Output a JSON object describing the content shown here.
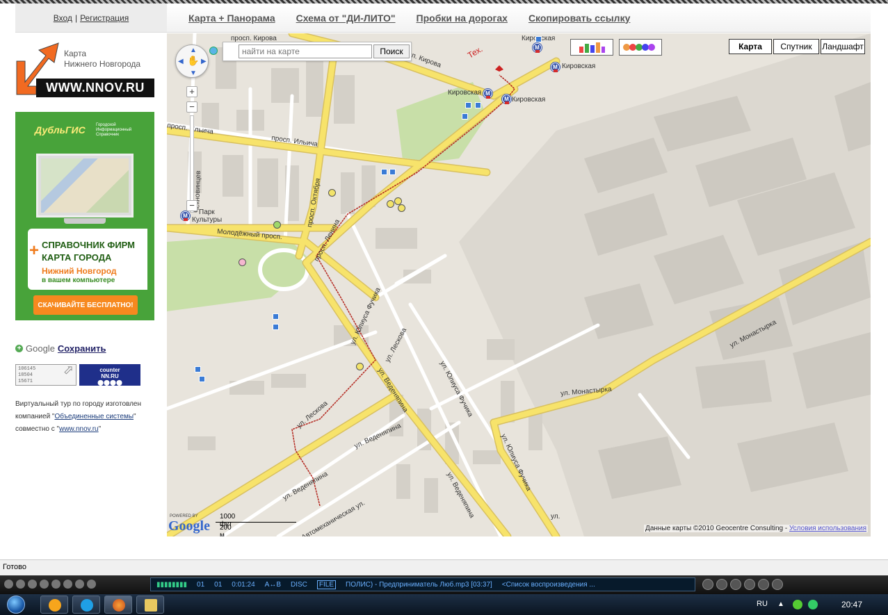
{
  "header": {
    "auth": {
      "login": "Вход",
      "separator": "|",
      "register": "Регистрация"
    },
    "nav": [
      {
        "label": "Карта + Панорама"
      },
      {
        "label": "Схема от \"ДИ-ЛИТО\""
      },
      {
        "label": "Пробки на дорогах"
      },
      {
        "label": "Скопировать ссылку"
      }
    ]
  },
  "sidebar": {
    "logo": {
      "line1": "Карта",
      "line2": "Нижнего Новгорода",
      "url": "WWW.NNOV.RU"
    },
    "banner": {
      "brand": "ДубльГИС",
      "brand_sub": "Городской Информационный Справочник",
      "line1": "СПРАВОЧНИК ФИРМ",
      "line2": "КАРТА ГОРОДА",
      "line3": "Нижний Новгород",
      "line4": "в вашем компьютере",
      "button": "СКАЧИВАЙТЕ БЕСПЛАТНО!"
    },
    "google_save": {
      "brand": "Google",
      "label": "Сохранить"
    },
    "counter1": {
      "l1": "106145",
      "l2": "18504",
      "l3": "15671"
    },
    "counter2": {
      "l1": "counter",
      "l2": "NN.RU"
    },
    "tour": {
      "t1": "Виртуальный тур по городу изготовлен компанией \"",
      "link1": "Объединенные системы",
      "t2": "\" совместно с \"",
      "link2": "www.nnov.ru",
      "t3": "\""
    }
  },
  "map": {
    "search": {
      "placeholder": "найти на карте",
      "button": "Поиск"
    },
    "types": [
      {
        "label": "Карта",
        "active": true
      },
      {
        "label": "Спутник"
      },
      {
        "label": "Ландшафт"
      }
    ],
    "labels": {
      "kirova_top": "просп. Кирова",
      "kirova": "просп. Кирова",
      "ilicha_left": "просп. Ильича",
      "ilicha": "просп. Ильича",
      "oktyabrya": "просп. Октября",
      "molodezhny": "Молодёжный просп.",
      "lenina": "просп. Ленина",
      "fuchika1": "ул. Юлиуса Фучика",
      "fuchika2": "ул. Юлиуса Фучика",
      "fuchika3": "ул. Юлиуса Фучика",
      "leskova1": "ул. Лескова",
      "leskova2": "ул. Лескова",
      "vedenyapina1": "ул. Веденяпина",
      "vedenyapina2": "ул. Веденяпина",
      "vedenyapina3": "ул. Веденяпина",
      "vedenyapina4": "ул. Веденяпина",
      "monastyrka1": "ул. Монастырка",
      "monastyrka2": "ул. Монастырка",
      "avtomeh": "Автомеханическая ул.",
      "chekhonin": "Чекновинцев",
      "park": "Парк",
      "park2": "Культуры",
      "kirovskaya1": "Кировская",
      "kirovskaya2": "Кировская",
      "kirovskaya3": "Кировская",
      "kirovskaya4": "Кировская",
      "tex": "Тех.",
      "ul_short": "ул."
    },
    "scale": {
      "ft": "1000 фут",
      "m": "200 м"
    },
    "powered": "POWERED BY",
    "google": "Google",
    "copyright": "Данные карты ©2010 Geocentre Consulting - ",
    "terms": "Условия использования"
  },
  "statusbar": {
    "text": "Готово"
  },
  "player": {
    "t1": "01",
    "t2": "01",
    "time": "0:01:24",
    "ab": "A↔B",
    "disc": "DISC",
    "file": "FILE",
    "track": "ПОЛИС) - Предприниматель Люб.mp3  [03:37]",
    "playlist": "<Список воспроизведения ..."
  },
  "taskbar": {
    "lang": "RU",
    "clock": "20:47"
  },
  "colors": {
    "road_major": "#f7e36b",
    "road_minor": "#ffffff",
    "route": "#b3261e",
    "park": "#c8dfa8",
    "bg": "#e8e4dc"
  }
}
